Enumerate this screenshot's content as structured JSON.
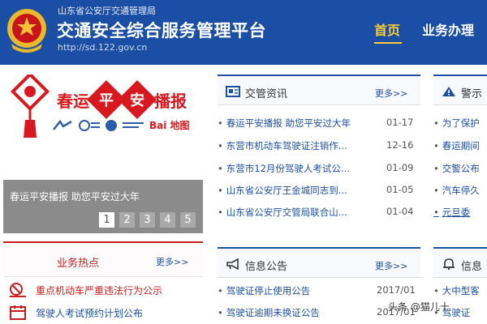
{
  "header": {
    "subtitle": "山东省公安厅交通管理局",
    "title": "交通安全综合服务管理平台",
    "url": "http://sd.122.gov.cn",
    "nav": [
      {
        "label": "首页",
        "active": true
      },
      {
        "label": "业务办理",
        "active": false
      }
    ]
  },
  "banner": {
    "slogan_left": "春运",
    "slogan_ping": "平",
    "slogan_an": "安",
    "slogan_right": "播报",
    "baidu_logo": "Bai 地图"
  },
  "slider": {
    "caption": "春运平安播报 助您平安过大年",
    "pages": [
      "1",
      "2",
      "3",
      "4",
      "5"
    ],
    "active_page": "1"
  },
  "hot_topics": {
    "title": "业务热点",
    "more": "更多>>",
    "items": [
      {
        "text": "重点机动车严重违法行为公示",
        "icon": "violation-icon"
      },
      {
        "text": "驾驶人考试预约计划公布",
        "icon": "calendar-icon"
      }
    ]
  },
  "panels": {
    "news": {
      "title": "交管资讯",
      "more": "更多>>",
      "icon": "newspaper-icon",
      "items": [
        {
          "text": "春运平安播报 助您平安过大年",
          "date": "01-17"
        },
        {
          "text": "东营市机动车驾驶证注销作...",
          "date": "12-16"
        },
        {
          "text": "东营市12月份驾驶人考试公...",
          "date": "01-09"
        },
        {
          "text": "山东省公安厅王金城同志到...",
          "date": "01-05"
        },
        {
          "text": "山东省公安厅交管局联合山...",
          "date": "01-04"
        }
      ]
    },
    "notices": {
      "title": "信息公告",
      "more": "更多>>",
      "icon": "megaphone-icon",
      "items": [
        {
          "text": "驾驶证停止使用公告",
          "date": "2017/01"
        },
        {
          "text": "驾驶证逾期未换证公告",
          "date": "2017/01"
        }
      ]
    },
    "alerts": {
      "title": "警示",
      "icon": "warning-icon",
      "items": [
        "为了保护",
        "春运期间",
        "交警公布",
        "汽车停久",
        "元旦委"
      ]
    },
    "info": {
      "title": "信息",
      "icon": "bell-icon",
      "items": [
        "大中型客",
        "驾驶证"
      ]
    }
  },
  "watermark": "头条 @猫儿十",
  "colors": {
    "header_bg": "#1b4fa6",
    "nav_active": "#ffcc33",
    "accent_red": "#c91d1d",
    "link_blue": "#1d4fa3",
    "slider_bg": "#8b8b8b"
  }
}
